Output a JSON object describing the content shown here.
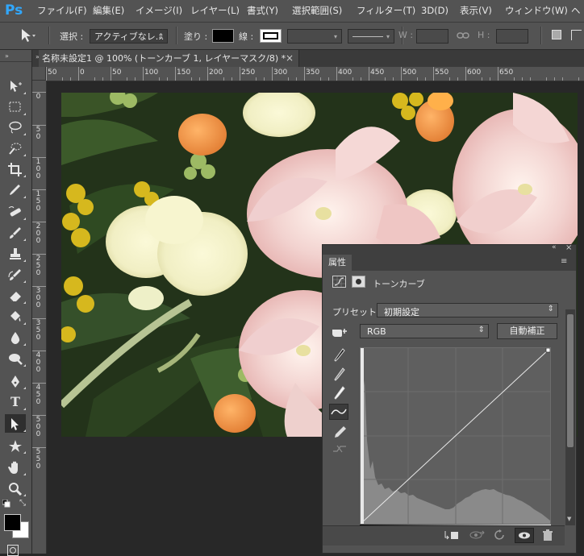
{
  "app": {
    "logo": "Ps",
    "accent": "#31a8ff"
  },
  "menu": [
    "ファイル(F)",
    "編集(E)",
    "イメージ(I)",
    "レイヤー(L)",
    "書式(Y)",
    "選択範囲(S)",
    "フィルター(T)",
    "3D(D)",
    "表示(V)",
    "ウィンドウ(W)",
    "ヘ"
  ],
  "options": {
    "select_label": "選択 :",
    "select_value": "アクティブなレ...",
    "fill_label": "塗り :",
    "stroke_label": "線 :",
    "w_label": "W :",
    "h_label": "H :"
  },
  "document": {
    "tab_title": "名称未設定1 @ 100% (トーンカーブ 1, レイヤーマスク/8) *",
    "close": "×"
  },
  "ruler": {
    "top": [
      "50",
      "0",
      "50",
      "100",
      "150",
      "200",
      "250",
      "300",
      "350",
      "400",
      "450",
      "500",
      "550",
      "600",
      "650"
    ],
    "left": [
      "0",
      "5\n0",
      "1\n0\n0",
      "1\n5\n0",
      "2\n0\n0",
      "2\n5\n0",
      "3\n0\n0",
      "3\n5\n0",
      "4\n0\n0",
      "4\n5\n0",
      "5\n0\n0",
      "5\n5\n0"
    ]
  },
  "toolbar": {
    "icons": [
      "move-tool-icon",
      "marquee-tool-icon",
      "lasso-tool-icon",
      "quick-select-tool-icon",
      "crop-tool-icon",
      "eyedropper-tool-icon",
      "healing-tool-icon",
      "brush-tool-icon",
      "stamp-tool-icon",
      "history-brush-tool-icon",
      "eraser-tool-icon",
      "paint-bucket-tool-icon",
      "blur-tool-icon",
      "dodge-tool-icon",
      "pen-tool-icon",
      "type-tool-icon",
      "path-select-tool-icon",
      "shape-tool-icon",
      "hand-tool-icon",
      "zoom-tool-icon"
    ],
    "type_glyph": "T",
    "foreground": "#000000",
    "background": "#ffffff"
  },
  "properties": {
    "title": "属性",
    "adjustment_name": "トーンカーブ",
    "preset_label": "プリセット :",
    "preset_value": "初期設定",
    "channel_value": "RGB",
    "auto_button": "自動補正"
  }
}
